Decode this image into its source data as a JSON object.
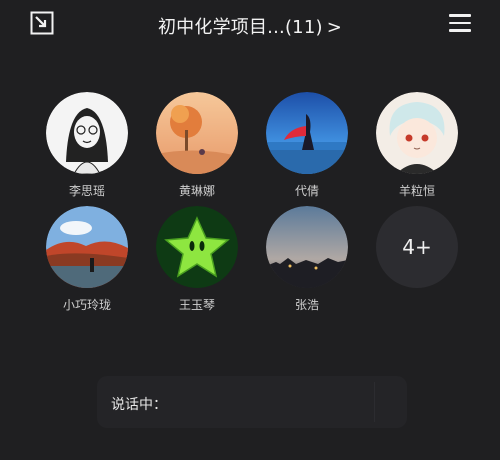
{
  "header": {
    "title": "初中化学项目...(11)",
    "chevron": ">",
    "collapse_icon": "collapse-icon",
    "menu_icon": "hamburger-menu-icon"
  },
  "members": [
    {
      "name": "李思瑶"
    },
    {
      "name": "黄琳娜"
    },
    {
      "name": "代倩"
    },
    {
      "name": "羊粒恒"
    },
    {
      "name": "小巧玲珑"
    },
    {
      "name": "王玉琴"
    },
    {
      "name": "张浩"
    }
  ],
  "more_label": "4+",
  "speaking": {
    "label": "说话中："
  },
  "colors": {
    "background": "#1f1f21",
    "text": "#f2f2f2",
    "card": "#242427"
  }
}
